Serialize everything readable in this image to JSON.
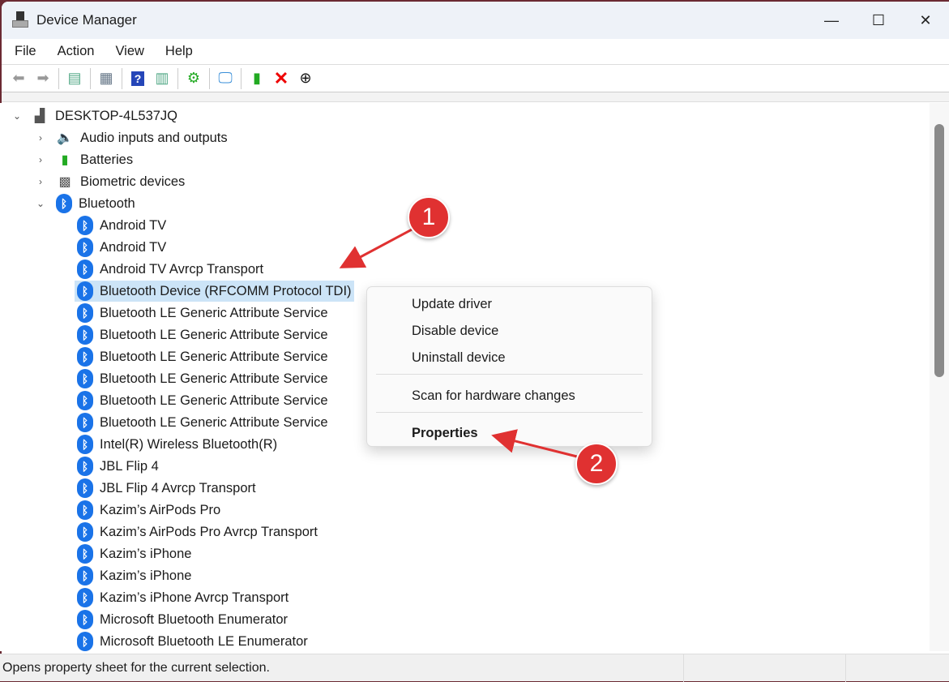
{
  "window": {
    "title": "Device Manager",
    "controls": [
      "minimize",
      "maximize",
      "close"
    ]
  },
  "menu": [
    "File",
    "Action",
    "View",
    "Help"
  ],
  "toolbar": [
    "back-icon",
    "forward-icon",
    "show-hide-console-tree-icon",
    "properties-icon",
    "help-icon",
    "action-pane-icon",
    "update-driver-icon",
    "scan-hardware-icon",
    "enable-device-icon",
    "uninstall-icon",
    "disable-device-icon"
  ],
  "tree": {
    "root": "DESKTOP-4L537JQ",
    "categories": [
      {
        "label": "Audio inputs and outputs",
        "expanded": false
      },
      {
        "label": "Batteries",
        "expanded": false
      },
      {
        "label": "Biometric devices",
        "expanded": false
      },
      {
        "label": "Bluetooth",
        "expanded": true
      }
    ],
    "bluetooth_devices": [
      "Android TV",
      "Android TV",
      "Android TV Avrcp Transport",
      "Bluetooth Device (RFCOMM Protocol TDI)",
      "Bluetooth LE Generic Attribute Service",
      "Bluetooth LE Generic Attribute Service",
      "Bluetooth LE Generic Attribute Service",
      "Bluetooth LE Generic Attribute Service",
      "Bluetooth LE Generic Attribute Service",
      "Bluetooth LE Generic Attribute Service",
      "Intel(R) Wireless Bluetooth(R)",
      "JBL Flip 4",
      "JBL Flip 4 Avrcp Transport",
      "Kazim’s AirPods Pro",
      "Kazim’s AirPods Pro Avrcp Transport",
      "Kazim’s iPhone",
      "Kazim’s iPhone",
      "Kazim’s iPhone Avrcp Transport",
      "Microsoft Bluetooth Enumerator",
      "Microsoft Bluetooth LE Enumerator"
    ],
    "selected_index": 3
  },
  "context_menu": {
    "items": [
      "Update driver",
      "Disable device",
      "Uninstall device",
      "Scan for hardware changes",
      "Properties"
    ]
  },
  "annotations": [
    "1",
    "2"
  ],
  "status": "Opens property sheet for the current selection.",
  "colors": {
    "accent": "#1a73e8",
    "annotation": "#e03131",
    "selection": "#cce4f7"
  }
}
